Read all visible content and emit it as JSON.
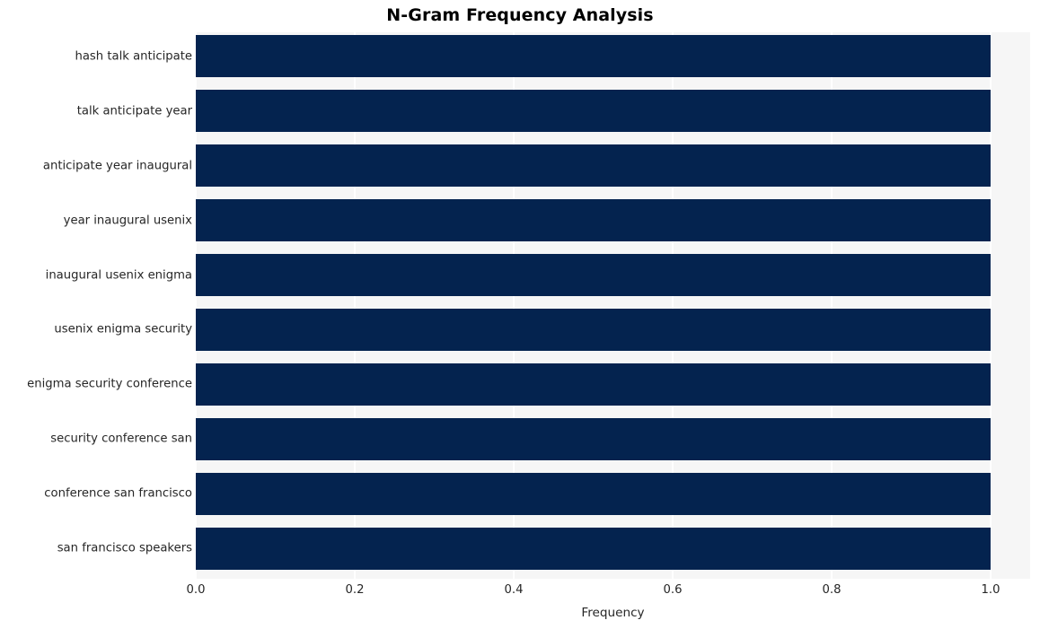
{
  "chart_data": {
    "type": "bar",
    "orientation": "horizontal",
    "title": "N-Gram Frequency Analysis",
    "xlabel": "Frequency",
    "ylabel": "",
    "xlim": [
      0.0,
      1.0
    ],
    "xticks": [
      "0.0",
      "0.2",
      "0.4",
      "0.6",
      "0.8",
      "1.0"
    ],
    "xtick_values": [
      0.0,
      0.2,
      0.4,
      0.6,
      0.8,
      1.0
    ],
    "grid": "vertical",
    "legend": "none",
    "bar_color": "#04234f",
    "plot_background": "#f6f6f6",
    "gridline_color": "#ffffff",
    "categories": [
      "hash talk anticipate",
      "talk anticipate year",
      "anticipate year inaugural",
      "year inaugural usenix",
      "inaugural usenix enigma",
      "usenix enigma security",
      "enigma security conference",
      "security conference san",
      "conference san francisco",
      "san francisco speakers"
    ],
    "values": [
      1.0,
      1.0,
      1.0,
      1.0,
      1.0,
      1.0,
      1.0,
      1.0,
      1.0,
      1.0
    ]
  }
}
